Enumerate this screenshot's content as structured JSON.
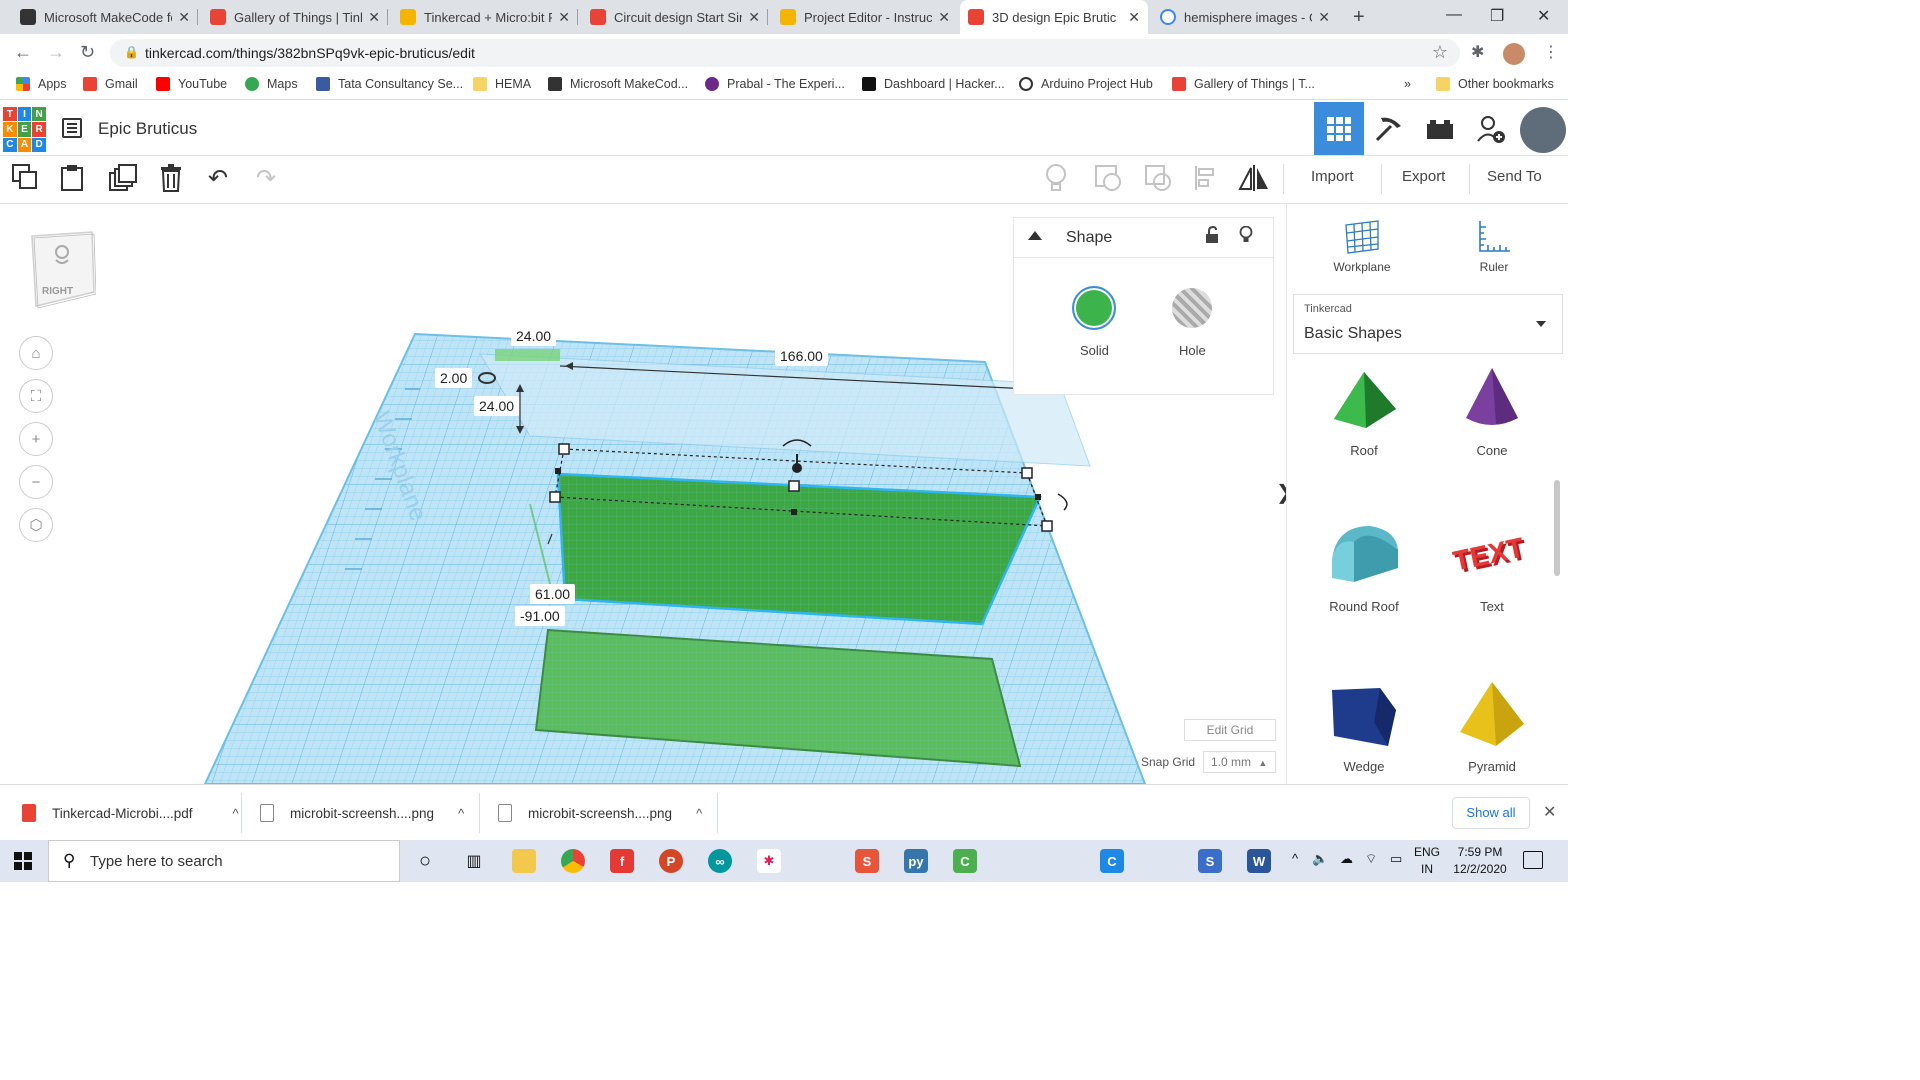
{
  "browser": {
    "tabs": [
      {
        "title": "Microsoft MakeCode fo",
        "icon": "makecode-icon",
        "color": "#333333"
      },
      {
        "title": "Gallery of Things | Tink",
        "icon": "tinkercad-icon",
        "color": "#e94335"
      },
      {
        "title": "Tinkercad + Micro:bit P",
        "icon": "instructables-icon",
        "color": "#f4b400"
      },
      {
        "title": "Circuit design Start Sim",
        "icon": "tinkercad-icon",
        "color": "#e94335"
      },
      {
        "title": "Project Editor - Instruct",
        "icon": "instructables-icon",
        "color": "#f4b400"
      },
      {
        "title": "3D design Epic Brutic",
        "icon": "tinkercad-icon",
        "color": "#e94335",
        "active": true
      },
      {
        "title": "hemisphere images - G",
        "icon": "google-icon",
        "color": "#4285f4"
      }
    ],
    "url": "tinkercad.com/things/382bnSPq9vk-epic-bruticus/edit",
    "bookmarks": [
      "Apps",
      "Gmail",
      "YouTube",
      "Maps",
      "Tata Consultancy Se...",
      "HEMA",
      "Microsoft MakeCod...",
      "Prabal - The Experi...",
      "Dashboard | Hacker...",
      "Arduino Project Hub",
      "Gallery of Things | T..."
    ],
    "bookmarks_overflow": "»",
    "other_bookmarks": "Other bookmarks"
  },
  "app": {
    "logo_letters": [
      "T",
      "I",
      "N",
      "K",
      "E",
      "R",
      "C",
      "A",
      "D"
    ],
    "design_title": "Epic Bruticus"
  },
  "toolbar": {
    "import": "Import",
    "export": "Export",
    "send_to": "Send To"
  },
  "viewcube": {
    "face": "RIGHT"
  },
  "dimensions": {
    "width_top": "24.00",
    "length": "166.00",
    "elevation": "2.00",
    "depth": "24.00",
    "height": "61.00",
    "position": "-91.00",
    "workplane_text": "Workplane"
  },
  "inspector": {
    "title": "Shape",
    "solid": "Solid",
    "hole": "Hole",
    "solid_color": "#3cb44b"
  },
  "grid": {
    "edit_grid": "Edit Grid",
    "snap_label": "Snap Grid",
    "snap_value": "1.0 mm"
  },
  "panel": {
    "workplane": "Workplane",
    "ruler": "Ruler",
    "library_caption": "Tinkercad",
    "library_value": "Basic Shapes",
    "shapes": [
      {
        "name": "Roof",
        "color": "#2e9e3e"
      },
      {
        "name": "Cone",
        "color": "#7b3fa0"
      },
      {
        "name": "Round Roof",
        "color": "#5ab8c8"
      },
      {
        "name": "Text",
        "color": "#d9232d"
      },
      {
        "name": "Wedge",
        "color": "#1f3b8c"
      },
      {
        "name": "Pyramid",
        "color": "#e8c21a"
      }
    ]
  },
  "downloads": {
    "items": [
      "Tinkercad-Microbi....pdf",
      "microbit-screensh....png",
      "microbit-screensh....png"
    ],
    "show_all": "Show all"
  },
  "taskbar": {
    "search_placeholder": "Type here to search",
    "lang_1": "ENG",
    "lang_2": "IN",
    "time": "7:59 PM",
    "date": "12/2/2020"
  }
}
